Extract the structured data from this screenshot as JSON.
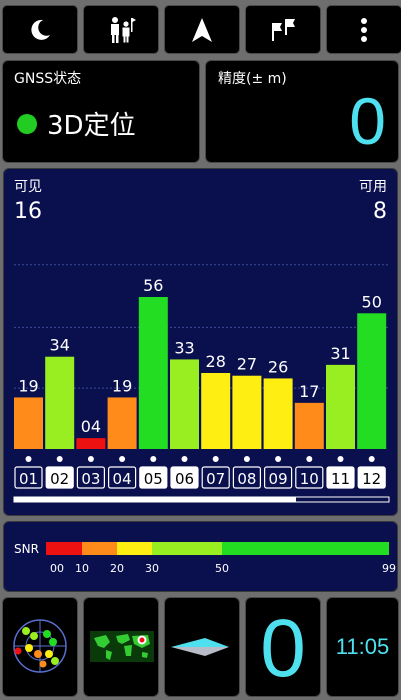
{
  "toolbar": {
    "buttons": [
      {
        "name": "night-mode-button",
        "icon": "moon-icon"
      },
      {
        "name": "share-location-button",
        "icon": "people-icon"
      },
      {
        "name": "navigation-button",
        "icon": "navigation-arrow-icon"
      },
      {
        "name": "waypoints-button",
        "icon": "flags-icon"
      },
      {
        "name": "menu-button",
        "icon": "more-vert-icon"
      }
    ]
  },
  "status": {
    "gnss_label": "GNSS状态",
    "fix_text": "3D定位",
    "fix_color": "#22cc22",
    "accuracy_label": "精度(± m)",
    "accuracy_value": "0",
    "accent": "#4fe0f0"
  },
  "satellites": {
    "visible_label": "可见",
    "visible_count": "16",
    "used_label": "可用",
    "used_count": "8"
  },
  "chart_data": {
    "type": "bar",
    "categories": [
      "01",
      "02",
      "03",
      "04",
      "05",
      "06",
      "07",
      "08",
      "09",
      "10",
      "11",
      "12"
    ],
    "values": [
      19,
      34,
      4,
      19,
      56,
      33,
      28,
      27,
      26,
      17,
      31,
      50
    ],
    "value_labels": [
      "19",
      "34",
      "04",
      "19",
      "56",
      "33",
      "28",
      "27",
      "26",
      "17",
      "31",
      "50"
    ],
    "used": [
      false,
      true,
      false,
      false,
      true,
      true,
      false,
      false,
      false,
      false,
      true,
      true
    ],
    "ylim": [
      0,
      70
    ],
    "grid": true
  },
  "snr_scale": {
    "label": "SNR",
    "ticks": [
      "00",
      "10",
      "20",
      "30",
      "50",
      "99"
    ],
    "segments": [
      {
        "from": 0,
        "to": 10,
        "color": "#ee1111"
      },
      {
        "from": 10,
        "to": 20,
        "color": "#ff8c1a"
      },
      {
        "from": 20,
        "to": 30,
        "color": "#ffee11"
      },
      {
        "from": 30,
        "to": 50,
        "color": "#99ee22"
      },
      {
        "from": 50,
        "to": 99,
        "color": "#22dd22"
      }
    ]
  },
  "bottom": {
    "radar_icon": "sky-plot-icon",
    "map_icon": "world-map-icon",
    "compass_icon": "compass-needle-icon",
    "speed_value": "0",
    "time": "11:05"
  }
}
